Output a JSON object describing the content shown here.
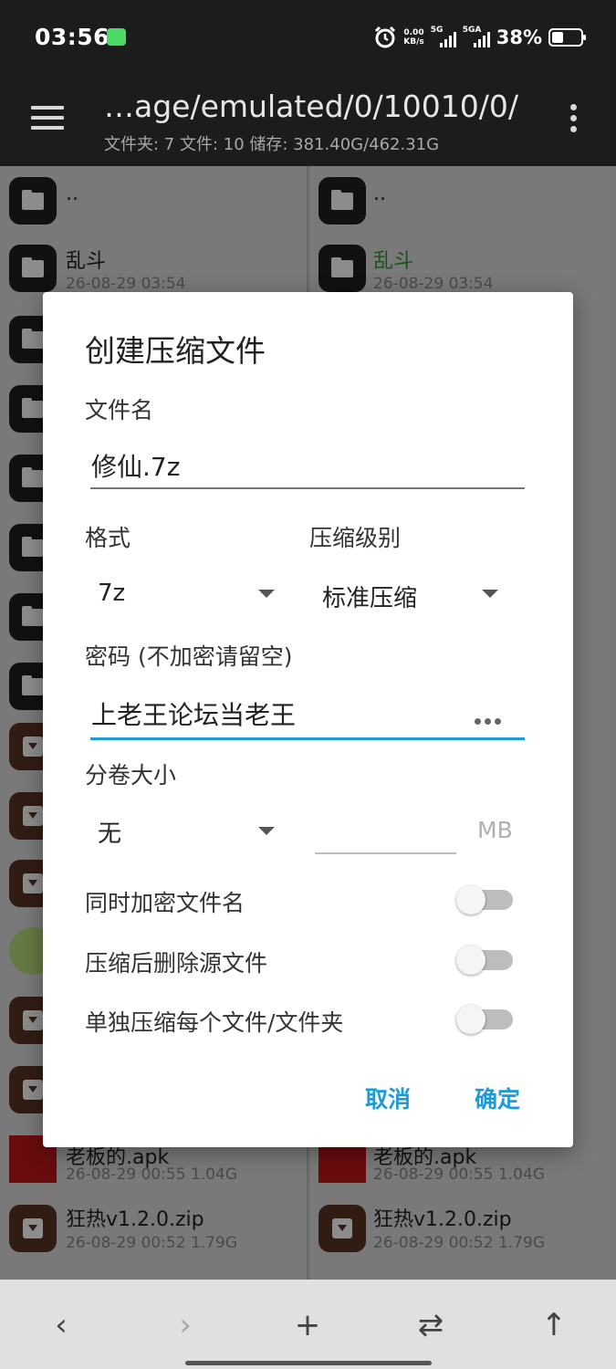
{
  "status_bar": {
    "time": "03:56",
    "speed_value": "0.00",
    "speed_unit": "KB/s",
    "net1": "5G",
    "net2": "5GA",
    "battery_pct": "38%"
  },
  "app_bar": {
    "path": "…age/emulated/0/10010/0/",
    "summary": "文件夹: 7  文件: 10  储存: 381.40G/462.31G"
  },
  "left_pane": {
    "parent": "..",
    "items": [
      {
        "name": "乱斗",
        "meta": "26-08-29 03:54"
      },
      {
        "name": "老板的.apk",
        "meta": "26-08-29 00:55  1.04G"
      },
      {
        "name": "狂热v1.2.0.zip",
        "meta": "26-08-29 00:52  1.79G"
      }
    ]
  },
  "right_pane": {
    "parent": "..",
    "items": [
      {
        "name": "乱斗",
        "meta": "26-08-29 03:54"
      },
      {
        "name": "老板的.apk",
        "meta": "26-08-29 00:55  1.04G"
      },
      {
        "name": "狂热v1.2.0.zip",
        "meta": "26-08-29 00:52  1.79G"
      }
    ]
  },
  "dialog": {
    "title": "创建压缩文件",
    "filename_label": "文件名",
    "filename_value": "修仙.7z",
    "format_label": "格式",
    "format_value": "7z",
    "level_label": "压缩级别",
    "level_value": "标准压缩",
    "password_label": "密码 (不加密请留空)",
    "password_value": "上老王论坛当老王",
    "volume_label": "分卷大小",
    "volume_value": "无",
    "volume_unit": "MB",
    "toggles": [
      {
        "label": "同时加密文件名",
        "on": false
      },
      {
        "label": "压缩后删除源文件",
        "on": false
      },
      {
        "label": "单独压缩每个文件/文件夹",
        "on": false
      }
    ],
    "cancel": "取消",
    "ok": "确定"
  },
  "bottom_bar": {
    "back": "‹",
    "forward": "›",
    "add": "+",
    "swap": "⇄",
    "up": "↑"
  },
  "colors": {
    "accent": "#1e9bd7",
    "dark_bar": "#1c1c1c",
    "folder_green": "#2f9a2f"
  }
}
